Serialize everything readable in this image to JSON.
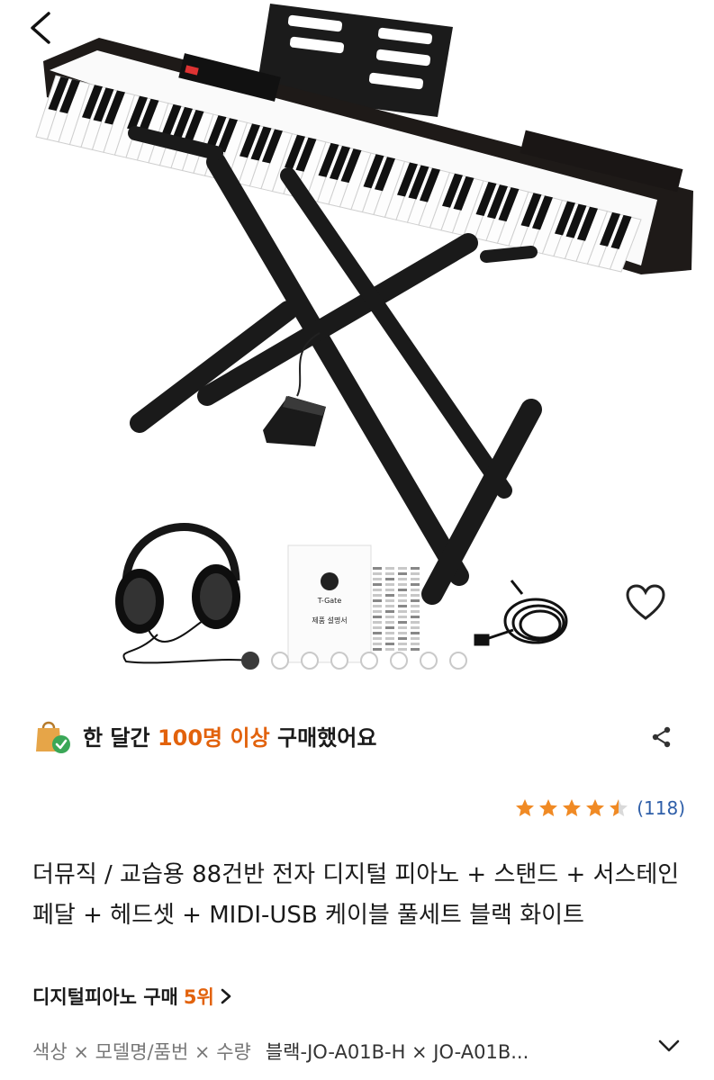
{
  "nav": {
    "back_icon": "chevron-left-icon"
  },
  "gallery": {
    "image_count": 8,
    "active_index": 0,
    "wishlist_icon": "heart-outline-icon",
    "booklet_brand": "T-Gate",
    "booklet_text": "제품 설명서"
  },
  "purchase": {
    "prefix": "한 달간 ",
    "highlight": "100명 이상",
    "suffix": " 구매했어요",
    "icon": "shopping-bag-check-icon",
    "share_icon": "share-icon"
  },
  "rating": {
    "stars": 4.5,
    "review_count": "(118)"
  },
  "product": {
    "title": "더뮤직 / 교습용 88건반 전자 디지털 피아노 + 스탠드 + 서스테인 페달 + 헤드셋 + MIDI-USB 케이블 풀세트 블랙 화이트"
  },
  "rank": {
    "category": "디지털피아노 구매",
    "position": "5위"
  },
  "options": {
    "names": "색상 × 모델명/품번 × 수량",
    "values": "블랙-JO-A01B-H × JO-A01B...",
    "chevron_icon": "chevron-down-icon"
  },
  "colors": {
    "accent": "#e2620c",
    "link": "#2e5ea8",
    "star": "#f08a24"
  }
}
